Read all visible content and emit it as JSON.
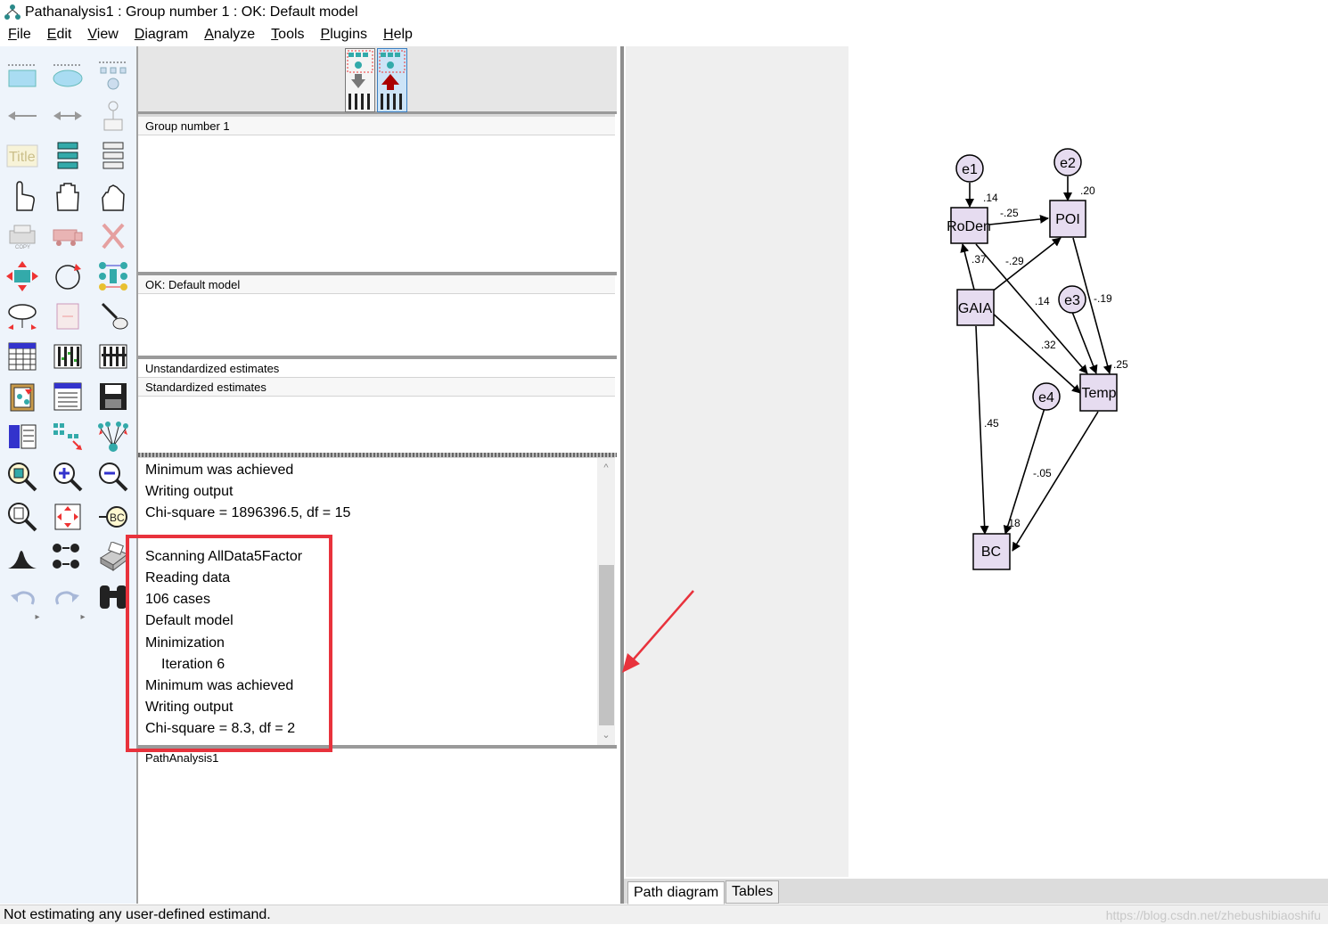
{
  "window": {
    "title": "Pathanalysis1 : Group number 1 : OK: Default model"
  },
  "menubar": {
    "items": [
      "File",
      "Edit",
      "View",
      "Diagram",
      "Analyze",
      "Tools",
      "Plugins",
      "Help"
    ]
  },
  "toolbox": {
    "tools": [
      "rectangle-icon",
      "ellipse-icon",
      "indicator-icon",
      "single-arrow-icon",
      "double-arrow-icon",
      "unique-variable-icon",
      "title-icon",
      "list-variables-icon",
      "list-dataset-icon",
      "select-one-icon",
      "select-all-icon",
      "deselect-all-icon",
      "copy-icon",
      "move-icon",
      "erase-icon",
      "resize-icon",
      "rotate-icon",
      "reflect-icon",
      "move-parameter-icon",
      "scroll-icon",
      "touch-up-icon",
      "data-files-icon",
      "analysis-properties-icon",
      "calculate-estimates-icon",
      "copy-clipboard-icon",
      "view-text-icon",
      "save-icon",
      "object-properties-icon",
      "drag-properties-icon",
      "preserve-symmetry-icon",
      "zoom-area-icon",
      "zoom-in-icon",
      "zoom-out-icon",
      "zoom-page-icon",
      "fit-page-icon",
      "loupe-icon",
      "bayesian-icon",
      "multiple-group-icon",
      "print-icon",
      "undo-icon",
      "redo-icon",
      "specification-search-icon"
    ],
    "title_tool_label": "Title"
  },
  "panel": {
    "groups_header": "Group number 1",
    "models_header": "OK: Default model",
    "estimates": [
      "Unstandardized estimates",
      "Standardized estimates"
    ],
    "log_lines": [
      {
        "text": "Minimum was achieved",
        "indent": false
      },
      {
        "text": "Writing output",
        "indent": false
      },
      {
        "text": "Chi-square = 1896396.5, df = 15",
        "indent": false
      },
      {
        "text": "",
        "indent": false
      },
      {
        "text": "Scanning AllData5Factor",
        "indent": false
      },
      {
        "text": "Reading data",
        "indent": false
      },
      {
        "text": "106 cases",
        "indent": false
      },
      {
        "text": "Default model",
        "indent": false
      },
      {
        "text": "Minimization",
        "indent": false
      },
      {
        "text": "Iteration 6",
        "indent": true
      },
      {
        "text": "Minimum was achieved",
        "indent": false
      },
      {
        "text": "Writing output",
        "indent": false
      },
      {
        "text": "Chi-square = 8.3, df = 2",
        "indent": false
      }
    ],
    "files_header": "PathAnalysis1"
  },
  "diagram": {
    "observed": [
      "RoDen",
      "POI",
      "GAIA",
      "Temp",
      "BC"
    ],
    "errors": [
      "e1",
      "e2",
      "e3",
      "e4"
    ],
    "coefficients": [
      ".14",
      "-.25",
      ".20",
      ".37",
      "-.29",
      ".14",
      "-.19",
      ".32",
      ".25",
      ".45",
      "-.05",
      ".18"
    ]
  },
  "tabs": [
    "Path diagram",
    "Tables"
  ],
  "status": {
    "text": "Not estimating any user-defined estimand.",
    "watermark": "https://blog.csdn.net/zhebushibiaoshifu"
  },
  "colors": {
    "node_fill": "#e6dcf0",
    "toolbox_bg": "#eef4fb",
    "highlight": "#e8323c",
    "arrow": "#e8323c"
  }
}
